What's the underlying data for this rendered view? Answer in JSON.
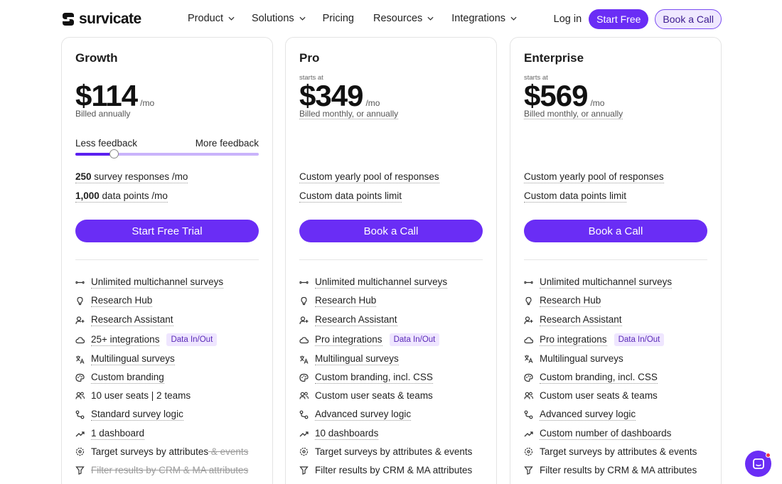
{
  "nav": {
    "logo": "survicate",
    "links": [
      {
        "label": "Product",
        "dropdown": true
      },
      {
        "label": "Solutions",
        "dropdown": true
      },
      {
        "label": "Pricing",
        "dropdown": false
      },
      {
        "label": "Resources",
        "dropdown": true
      },
      {
        "label": "Integrations",
        "dropdown": true
      }
    ],
    "login": "Log in",
    "start_free": "Start Free",
    "book_call": "Book a Call"
  },
  "plans": [
    {
      "name": "Growth",
      "starts_at": "",
      "price": "$114",
      "per": "/mo",
      "billed": "Billed annually",
      "slider": {
        "min_label": "Less feedback",
        "max_label": "More feedback",
        "value": 0.21
      },
      "quota1": {
        "bold": "250",
        "text": " survey responses /mo"
      },
      "quota2": {
        "bold": "1,000",
        "text": " data points /mo"
      },
      "cta": "Start Free Trial",
      "features": [
        {
          "icon": "infinity-icon",
          "text": "Unlimited multichannel surveys",
          "ul": true
        },
        {
          "icon": "lightbulb-icon",
          "text": "Research Hub",
          "ul": true
        },
        {
          "icon": "user-sparkle-icon",
          "text": "Research Assistant",
          "ul": true
        },
        {
          "icon": "cloud-icon",
          "text": "25+ integrations",
          "ul": true,
          "badge": "Data In/Out"
        },
        {
          "icon": "translate-icon",
          "text": "Multilingual surveys",
          "ul": true
        },
        {
          "icon": "palette-icon",
          "text": "Custom branding",
          "ul": true
        },
        {
          "icon": "users-icon",
          "text": "10 user seats | 2 teams",
          "ul": false
        },
        {
          "icon": "logic-icon",
          "text": "Standard survey logic",
          "ul": true
        },
        {
          "icon": "trend-icon",
          "text": "1 dashboard",
          "ul": true
        },
        {
          "icon": "target-icon",
          "text": "Target surveys by attributes",
          "strike_suffix": " & events",
          "ul": false
        },
        {
          "icon": "filter-icon",
          "text": "Filter results by CRM & MA attributes",
          "ul": false,
          "muted": true
        }
      ]
    },
    {
      "name": "Pro",
      "starts_at": "starts at",
      "price": "$349",
      "per": "/mo",
      "billed": "Billed monthly, or annually",
      "quota1": {
        "bold": "",
        "text": "Custom yearly pool of responses"
      },
      "quota2": {
        "bold": "",
        "text": "Custom data points limit"
      },
      "cta": "Book a Call",
      "features": [
        {
          "icon": "infinity-icon",
          "text": "Unlimited multichannel surveys",
          "ul": true
        },
        {
          "icon": "lightbulb-icon",
          "text": "Research Hub",
          "ul": true
        },
        {
          "icon": "user-sparkle-icon",
          "text": "Research Assistant",
          "ul": true
        },
        {
          "icon": "cloud-icon",
          "text": "Pro integrations",
          "ul": true,
          "badge": "Data In/Out"
        },
        {
          "icon": "translate-icon",
          "text": "Multilingual surveys",
          "ul": true
        },
        {
          "icon": "palette-icon",
          "text": "Custom branding, incl. CSS",
          "ul": true
        },
        {
          "icon": "users-icon",
          "text": "Custom user seats & teams",
          "ul": false
        },
        {
          "icon": "logic-icon",
          "text": "Advanced survey logic",
          "ul": true
        },
        {
          "icon": "trend-icon",
          "text": "10 dashboards",
          "ul": true
        },
        {
          "icon": "target-icon",
          "text": "Target surveys by attributes & events",
          "ul": false
        },
        {
          "icon": "filter-icon",
          "text": "Filter results by CRM & MA attributes",
          "ul": false
        }
      ]
    },
    {
      "name": "Enterprise",
      "starts_at": "starts at",
      "price": "$569",
      "per": "/mo",
      "billed": "Billed monthly, or annually",
      "quota1": {
        "bold": "",
        "text": "Custom yearly pool of responses"
      },
      "quota2": {
        "bold": "",
        "text": "Custom data points limit"
      },
      "cta": "Book a Call",
      "features": [
        {
          "icon": "infinity-icon",
          "text": "Unlimited multichannel surveys",
          "ul": true
        },
        {
          "icon": "lightbulb-icon",
          "text": "Research Hub",
          "ul": true
        },
        {
          "icon": "user-sparkle-icon",
          "text": "Research Assistant",
          "ul": true
        },
        {
          "icon": "cloud-icon",
          "text": "Pro integrations",
          "ul": true,
          "badge": "Data In/Out"
        },
        {
          "icon": "translate-icon",
          "text": "Multilingual surveys",
          "ul": false
        },
        {
          "icon": "palette-icon",
          "text": "Custom branding, incl. CSS",
          "ul": true
        },
        {
          "icon": "users-icon",
          "text": "Custom user seats & teams",
          "ul": false
        },
        {
          "icon": "logic-icon",
          "text": "Advanced survey logic",
          "ul": true
        },
        {
          "icon": "trend-icon",
          "text": "Custom number of dashboards",
          "ul": true
        },
        {
          "icon": "target-icon",
          "text": "Target surveys by attributes & events",
          "ul": false
        },
        {
          "icon": "filter-icon",
          "text": "Filter results by CRM & MA attributes",
          "ul": false
        }
      ]
    }
  ],
  "colors": {
    "accent": "#6a2df5",
    "badge_bg": "#efe6ff",
    "badge_text": "#5a2ab8"
  }
}
